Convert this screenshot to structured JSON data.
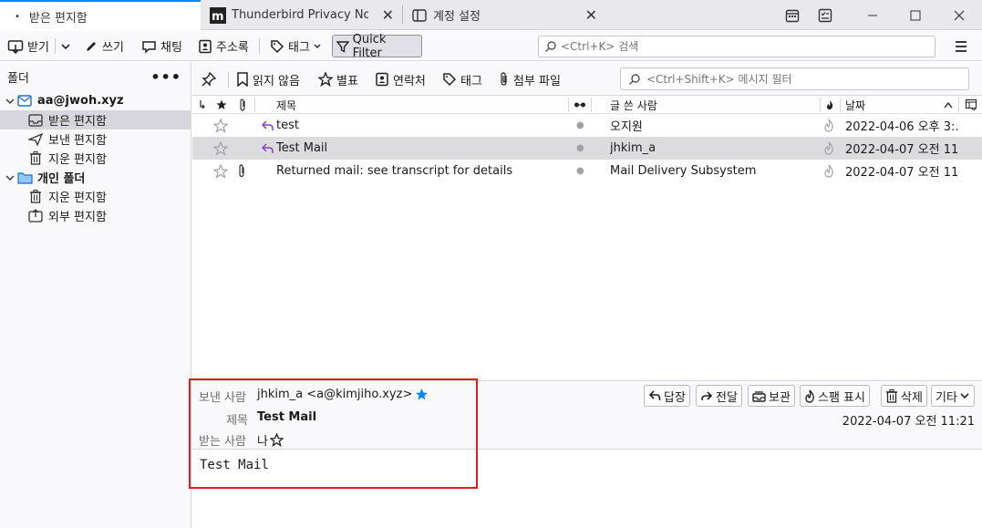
{
  "tabs": [
    {
      "label": "받은 편지함",
      "active": true
    },
    {
      "label": "Thunderbird Privacy Notice",
      "active": false
    },
    {
      "label": "계정 설정",
      "active": false
    }
  ],
  "toolbar": {
    "get_label": "받기",
    "write_label": "쓰기",
    "chat_label": "채팅",
    "addressbook_label": "주소록",
    "tag_label": "태그",
    "quickfilter_label": "Quick Filter",
    "search_placeholder": "<Ctrl+K> 검색"
  },
  "folder_pane": {
    "title": "폴더",
    "account": "aa@jwoh.xyz",
    "account_folders": [
      {
        "label": "받은 편지함",
        "icon": "inbox-icon",
        "selected": true
      },
      {
        "label": "보낸 편지함",
        "icon": "sent-icon",
        "selected": false
      },
      {
        "label": "지운 편지함",
        "icon": "trash-icon",
        "selected": false
      }
    ],
    "local": "개인 폴더",
    "local_folders": [
      {
        "label": "지운 편지함",
        "icon": "trash-icon"
      },
      {
        "label": "외부 편지함",
        "icon": "outbox-icon"
      }
    ]
  },
  "quick_filter": {
    "unread_label": "읽지 않음",
    "starred_label": "별표",
    "contact_label": "연락처",
    "tags_label": "태그",
    "attachment_label": "첨부 파일",
    "filter_placeholder": "<Ctrl+Shift+K> 메시지 필터"
  },
  "columns": {
    "subject": "제목",
    "sender": "글 쓴 사람",
    "date": "날짜"
  },
  "messages": [
    {
      "subject": "test",
      "sender": "오지원",
      "date": "2022-04-06 오후 3:...",
      "replied": true,
      "attachment": false,
      "selected": false
    },
    {
      "subject": "Test Mail",
      "sender": "jhkim_a",
      "date": "2022-04-07 오전 11...",
      "replied": true,
      "attachment": false,
      "selected": true
    },
    {
      "subject": "Returned mail: see transcript for details",
      "sender": "Mail Delivery Subsystem",
      "date": "2022-04-07 오전 11...",
      "replied": false,
      "attachment": true,
      "selected": false
    }
  ],
  "header": {
    "from_label": "보낸 사람",
    "from_value": "jhkim_a <a@kimjiho.xyz>",
    "subject_label": "제목",
    "subject_value": "Test Mail",
    "to_label": "받는 사람",
    "to_value": "나",
    "date_value": "2022-04-07 오전 11:21",
    "buttons": {
      "reply": "답장",
      "forward": "전달",
      "archive": "보관",
      "junk": "스팸 표시",
      "delete": "삭제",
      "more": "기타"
    }
  },
  "body_text": "Test Mail",
  "colors": {
    "accent": "#0a84ff",
    "highlight": "#e02020",
    "reply_arrow": "#8a3ec6"
  }
}
